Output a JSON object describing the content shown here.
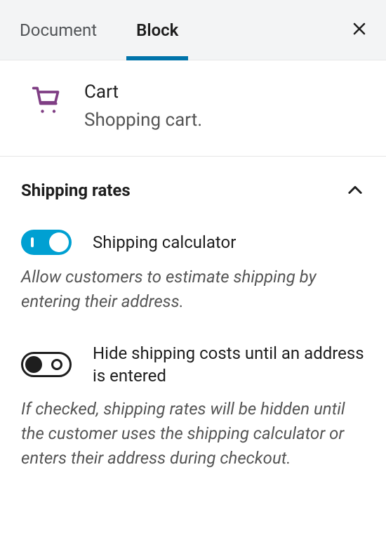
{
  "tabs": {
    "document": "Document",
    "block": "Block"
  },
  "block": {
    "title": "Cart",
    "description": "Shopping cart."
  },
  "panel": {
    "title": "Shipping rates",
    "settings": {
      "calculator": {
        "label": "Shipping calculator",
        "help": "Allow customers to estimate shipping by entering their address.",
        "value": true
      },
      "hide_costs": {
        "label": "Hide shipping costs until an address is entered",
        "help": "If checked, shipping rates will be hidden until the customer uses the shipping calculator or enters their address during checkout.",
        "value": false
      }
    }
  }
}
